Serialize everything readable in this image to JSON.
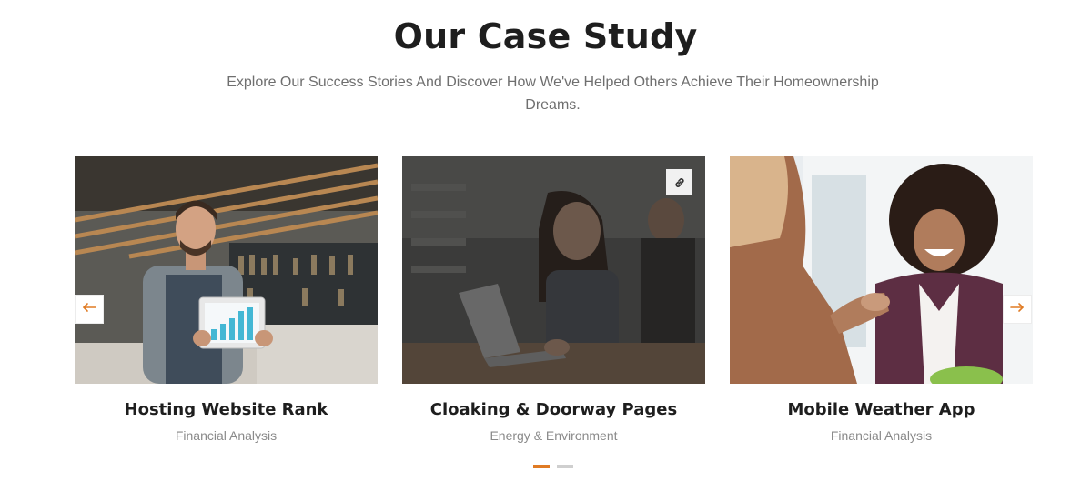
{
  "section": {
    "title": "Our Case Study",
    "subtitle": "Explore Our Success Stories And Discover How We've Helped Others Achieve Their Homeownership Dreams."
  },
  "cards": [
    {
      "title": "Hosting Website Rank",
      "category": "Financial Analysis",
      "image": "barista-with-tablet-photo"
    },
    {
      "title": "Cloaking & Doorway Pages",
      "category": "Energy & Environment",
      "image": "woman-with-laptop-photo",
      "hover_icon": "link-icon"
    },
    {
      "title": "Mobile Weather App",
      "category": "Financial Analysis",
      "image": "handshake-smiling-woman-photo"
    }
  ],
  "navigation": {
    "prev_icon": "arrow-left-icon",
    "next_icon": "arrow-right-icon"
  },
  "pagination": {
    "pages": 2,
    "active": 1
  },
  "colors": {
    "accent": "#e07b24",
    "title": "#1e1e1e",
    "subtitle": "#6f6f6f",
    "category": "#8a8a8a"
  }
}
